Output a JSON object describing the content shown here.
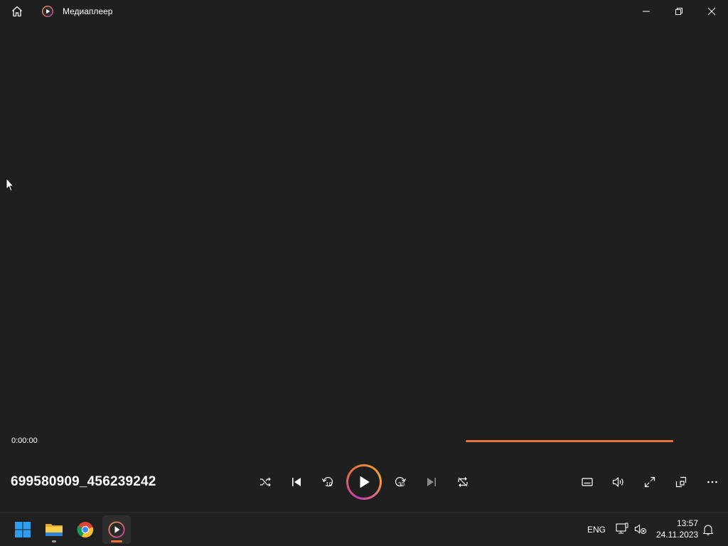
{
  "window": {
    "title": "Медиаплеер",
    "controls": [
      "minimize",
      "restore",
      "close"
    ]
  },
  "player": {
    "current_time": "0:00:00",
    "media_title": "699580909_456239242",
    "accent_color": "#e8743b",
    "controls_center": [
      "shuffle-icon",
      "previous-icon",
      "skip-back-10-icon",
      "play-icon",
      "skip-forward-30-icon",
      "next-icon",
      "repeat-icon"
    ],
    "skip_back_seconds": "10",
    "skip_forward_seconds": "30",
    "controls_right": [
      "subtitles-icon",
      "volume-icon",
      "fullscreen-icon",
      "mini-player-icon",
      "more-icon"
    ]
  },
  "taskbar": {
    "apps": [
      "start-icon",
      "file-explorer-icon",
      "chrome-icon",
      "media-player-icon"
    ],
    "language": "ENG",
    "time": "13:57",
    "date": "24.11.2023"
  }
}
